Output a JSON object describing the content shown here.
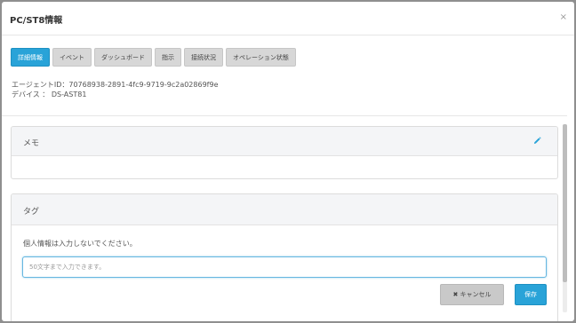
{
  "dialog": {
    "title": "PC/ST8情報",
    "close_glyph": "×"
  },
  "tabs": [
    {
      "label": "詳細情報",
      "active": true
    },
    {
      "label": "イベント",
      "active": false
    },
    {
      "label": "ダッシュボード",
      "active": false
    },
    {
      "label": "指示",
      "active": false
    },
    {
      "label": "接続状況",
      "active": false
    },
    {
      "label": "オペレーション状態",
      "active": false
    }
  ],
  "info": {
    "agent_line": "エージェントID：70768938-2891-4fc9-9719-9c2a02869f9e",
    "device_line": "デバイス ： DS-AST81"
  },
  "memo": {
    "title": "メモ",
    "edit_icon": "pencil-icon"
  },
  "tag": {
    "title": "タグ",
    "note": "個人情報は入力しないでください。",
    "input_placeholder": "50文字まで入力できます。",
    "cancel_label": "✖ キャンセル",
    "save_label": "保存"
  },
  "colors": {
    "accent": "#29a3d8",
    "tab_inactive": "#d7d7d7",
    "panel_header": "#f4f5f7",
    "overlay": "#8f8f8f"
  }
}
